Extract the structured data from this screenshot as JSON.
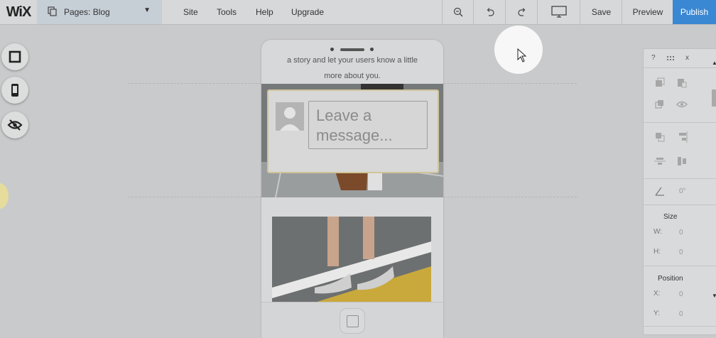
{
  "app": {
    "logo": "WiX"
  },
  "pages": {
    "label": "Pages: Blog"
  },
  "menu": {
    "items": [
      "Site",
      "Tools",
      "Help",
      "Upgrade"
    ]
  },
  "toolbar": {
    "save": "Save",
    "preview": "Preview",
    "publish": "Publish"
  },
  "colors": {
    "publish_bg": "#3a87d3",
    "topbar_bg": "#d7d8d9",
    "pages_bg": "#c6ced6"
  },
  "phone": {
    "story_line1": "a story and let your users know a little",
    "story_line2": "more about you.",
    "message_placeholder_line1": "Leave a",
    "message_placeholder_line2": "message..."
  },
  "panel": {
    "help": "?",
    "close": "x",
    "rotation": "0°",
    "size_title": "Size",
    "w_label": "W:",
    "w_value": "0",
    "h_label": "H:",
    "h_value": "0",
    "position_title": "Position",
    "x_label": "X:",
    "x_value": "0",
    "y_label": "Y:",
    "y_value": "0"
  },
  "icons": [
    "zoom-out-icon",
    "undo-icon",
    "redo-icon",
    "desktop-icon",
    "square-icon",
    "mobile-icon",
    "hidden-eye-icon",
    "drag-handle-icon"
  ]
}
